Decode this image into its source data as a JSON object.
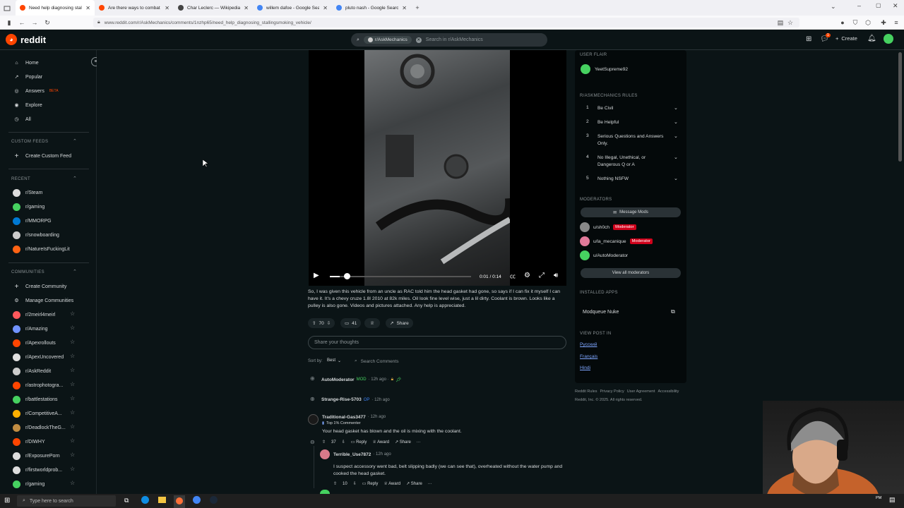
{
  "browser": {
    "tabs": [
      {
        "title": "Need help diagnosing stalling/s",
        "color": "#ff4500",
        "active": true
      },
      {
        "title": "Are there ways to combat light",
        "color": "#ff4500",
        "active": false
      },
      {
        "title": "Char Leclerc — Wikipedia",
        "color": "#444",
        "active": false
      },
      {
        "title": "willem dafoe - Google Search",
        "color": "#4285f4",
        "active": false
      },
      {
        "title": "pluto nash - Google Search",
        "color": "#4285f4",
        "active": false
      }
    ],
    "new_tab": "+",
    "url": "www.reddit.com/r/AskMechanics/comments/1nzhp65/need_help_diagnosing_stallingsmoking_vehicle/"
  },
  "header": {
    "logo_text": "reddit",
    "search_chip": "r/AskMechanics",
    "search_placeholder": "Search in r/AskMechanics",
    "create_label": "Create",
    "notif_count": "1"
  },
  "sidebar": {
    "nav": [
      {
        "label": "Home",
        "icon": "home-icon",
        "glyph": "⌂"
      },
      {
        "label": "Popular",
        "icon": "popular-icon",
        "glyph": "↗"
      },
      {
        "label": "Answers",
        "icon": "answers-icon",
        "glyph": "◎",
        "badge": "BETA"
      },
      {
        "label": "Explore",
        "icon": "explore-icon",
        "glyph": "◉"
      },
      {
        "label": "All",
        "icon": "all-icon",
        "glyph": "◷"
      }
    ],
    "custom_feeds_heading": "CUSTOM FEEDS",
    "create_custom_feed": "Create Custom Feed",
    "recent_heading": "RECENT",
    "recent": [
      {
        "label": "r/Steam",
        "color": "#dddddd"
      },
      {
        "label": "r/gaming",
        "color": "#46d160"
      },
      {
        "label": "r/MMORPG",
        "color": "#0079d3"
      },
      {
        "label": "r/snowboarding",
        "color": "#cccccc"
      },
      {
        "label": "r/NatureIsFuckingLit",
        "color": "#ff6314"
      }
    ],
    "communities_heading": "COMMUNITIES",
    "create_community": "Create Community",
    "manage_communities": "Manage Communities",
    "communities": [
      {
        "label": "r/2meirl4meirl",
        "color": "#ff585b"
      },
      {
        "label": "r/Amazing",
        "color": "#7193ff"
      },
      {
        "label": "r/Apexrollouts",
        "color": "#ff4500"
      },
      {
        "label": "r/ApexUncovered",
        "color": "#e0e0e0"
      },
      {
        "label": "r/AskReddit",
        "color": "#cccccc"
      },
      {
        "label": "r/astrophotogra...",
        "color": "#ff4500"
      },
      {
        "label": "r/battlestations",
        "color": "#46d160"
      },
      {
        "label": "r/CompetitiveA...",
        "color": "#ffb000"
      },
      {
        "label": "r/DeadlockTheG...",
        "color": "#c18d42"
      },
      {
        "label": "r/DIWHY",
        "color": "#ff4500"
      },
      {
        "label": "r/ExposurePorn",
        "color": "#dddddd"
      },
      {
        "label": "r/firstworldprob...",
        "color": "#dddddd"
      },
      {
        "label": "r/gaming",
        "color": "#46d160"
      }
    ]
  },
  "video": {
    "time": "0:01 / 0:14",
    "progress": 0.07
  },
  "post": {
    "body": "So, I was given this vehicle from an uncle as RAC told him the head gasket had gone, so says if I can fix it myself I can have it. It's a chevy cruze 1.8l 2010 at 82k miles. Oil look fine level wise, just a lil dirty. Coolant is brown. Looks like a pulley is also gone. Videos and pictures attached. Any help is appreciated.",
    "votes": "70",
    "comments": "41",
    "share": "Share",
    "comment_placeholder": "Share your thoughts",
    "sort_label": "Sort by:",
    "sort_value": "Best",
    "search_comments": "Search Comments"
  },
  "comments": [
    {
      "user": "AutoModerator",
      "tag": "MOD",
      "time": "· 12h ago ·"
    },
    {
      "user": "Strange-Rise-5703",
      "tag": "OP",
      "time": "· 12h ago"
    },
    {
      "user": "Traditional-Gas3477",
      "time": "· 12h ago",
      "flair": "Top 1% Commenter",
      "text": "Your head gasket has blown and the oil is mixing with the coolant.",
      "votes": "37",
      "reply": "Reply",
      "award": "Award",
      "share": "Share",
      "more": "···"
    },
    {
      "user": "Terrible_Use7872",
      "time": "· 12h ago",
      "text": "I suspect accessory went bad, belt slipping badly (we can see that), overheated without the water pump and cooked the head gasket.",
      "votes": "10",
      "reply": "Reply",
      "award": "Award",
      "share": "Share",
      "more": "···"
    }
  ],
  "rail": {
    "user_flair_heading": "USER FLAIR",
    "user_flair_name": "YeetSupreme92",
    "rules_heading": "R/ASKMECHANICS RULES",
    "rules": [
      {
        "n": "1",
        "text": "Be Civil"
      },
      {
        "n": "2",
        "text": "Be Helpful"
      },
      {
        "n": "3",
        "text": "Serious Questions and Answers Only."
      },
      {
        "n": "4",
        "text": "No Illegal, Unethical, or Dangerous Q or A"
      },
      {
        "n": "5",
        "text": "Nothing NSFW"
      }
    ],
    "moderators_heading": "MODERATORS",
    "message_mods": "Message Mods",
    "moderators": [
      {
        "name": "u/sh0ch",
        "badge": "Moderator",
        "color": "#888"
      },
      {
        "name": "u/la_mecanique",
        "badge": "Moderator",
        "color": "#e17a9a"
      },
      {
        "name": "u/AutoModerator",
        "badge": "",
        "color": "#46d160"
      }
    ],
    "view_all_mods": "View all moderators",
    "installed_apps_heading": "INSTALLED APPS",
    "app_name": "Modqueue Nuke",
    "view_post_in_heading": "VIEW POST IN",
    "languages": [
      "Русский",
      "Français",
      "Hindi"
    ],
    "footer_links": [
      "Reddit Rules",
      "Privacy Policy",
      "User Agreement",
      "Accessibility"
    ],
    "copyright": "Reddit, Inc. © 2025. All rights reserved."
  },
  "taskbar": {
    "search_placeholder": "Type here to search",
    "clock": "PM"
  }
}
